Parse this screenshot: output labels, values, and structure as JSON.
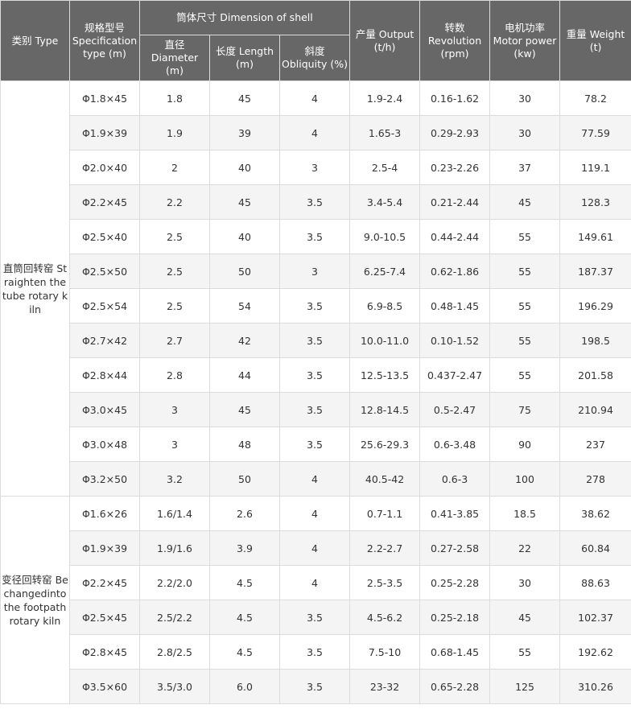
{
  "headers": {
    "type": "类别 Type",
    "spec": "规格型号 Specification type (m)",
    "shell": "筒体尺寸 Dimension of shell",
    "diameter": "直径 Diameter (m)",
    "length": "长度 Length (m)",
    "obliquity": "斜度 Obliquity (%)",
    "output": "产量 Output (t/h)",
    "revolution": "转数 Revolution (rpm)",
    "power": "电机功率 Motor power (kw)",
    "weight": "重量 Weight (t)"
  },
  "groups": [
    {
      "type": "直筒回转窑 Straighten the tube rotary kiln",
      "rows": [
        {
          "spec": "Φ1.8×45",
          "diameter": "1.8",
          "length": "45",
          "obliquity": "4",
          "output": "1.9-2.4",
          "revolution": "0.16-1.62",
          "power": "30",
          "weight": "78.2"
        },
        {
          "spec": "Φ1.9×39",
          "diameter": "1.9",
          "length": "39",
          "obliquity": "4",
          "output": "1.65-3",
          "revolution": "0.29-2.93",
          "power": "30",
          "weight": "77.59"
        },
        {
          "spec": "Φ2.0×40",
          "diameter": "2",
          "length": "40",
          "obliquity": "3",
          "output": "2.5-4",
          "revolution": "0.23-2.26",
          "power": "37",
          "weight": "119.1"
        },
        {
          "spec": "Φ2.2×45",
          "diameter": "2.2",
          "length": "45",
          "obliquity": "3.5",
          "output": "3.4-5.4",
          "revolution": "0.21-2.44",
          "power": "45",
          "weight": "128.3"
        },
        {
          "spec": "Φ2.5×40",
          "diameter": "2.5",
          "length": "40",
          "obliquity": "3.5",
          "output": "9.0-10.5",
          "revolution": "0.44-2.44",
          "power": "55",
          "weight": "149.61"
        },
        {
          "spec": "Φ2.5×50",
          "diameter": "2.5",
          "length": "50",
          "obliquity": "3",
          "output": "6.25-7.4",
          "revolution": "0.62-1.86",
          "power": "55",
          "weight": "187.37"
        },
        {
          "spec": "Φ2.5×54",
          "diameter": "2.5",
          "length": "54",
          "obliquity": "3.5",
          "output": "6.9-8.5",
          "revolution": "0.48-1.45",
          "power": "55",
          "weight": "196.29"
        },
        {
          "spec": "Φ2.7×42",
          "diameter": "2.7",
          "length": "42",
          "obliquity": "3.5",
          "output": "10.0-11.0",
          "revolution": "0.10-1.52",
          "power": "55",
          "weight": "198.5"
        },
        {
          "spec": "Φ2.8×44",
          "diameter": "2.8",
          "length": "44",
          "obliquity": "3.5",
          "output": "12.5-13.5",
          "revolution": "0.437-2.47",
          "power": "55",
          "weight": "201.58"
        },
        {
          "spec": "Φ3.0×45",
          "diameter": "3",
          "length": "45",
          "obliquity": "3.5",
          "output": "12.8-14.5",
          "revolution": "0.5-2.47",
          "power": "75",
          "weight": "210.94"
        },
        {
          "spec": "Φ3.0×48",
          "diameter": "3",
          "length": "48",
          "obliquity": "3.5",
          "output": "25.6-29.3",
          "revolution": "0.6-3.48",
          "power": "90",
          "weight": "237"
        },
        {
          "spec": "Φ3.2×50",
          "diameter": "3.2",
          "length": "50",
          "obliquity": "4",
          "output": "40.5-42",
          "revolution": "0.6-3",
          "power": "100",
          "weight": "278"
        }
      ]
    },
    {
      "type": "变径回转窑 Bechangedinto the footpath rotary kiln",
      "rows": [
        {
          "spec": "Φ1.6×26",
          "diameter": "1.6/1.4",
          "length": "2.6",
          "obliquity": "4",
          "output": "0.7-1.1",
          "revolution": "0.41-3.85",
          "power": "18.5",
          "weight": "38.62"
        },
        {
          "spec": "Φ1.9×39",
          "diameter": "1.9/1.6",
          "length": "3.9",
          "obliquity": "4",
          "output": "2.2-2.7",
          "revolution": "0.27-2.58",
          "power": "22",
          "weight": "60.84"
        },
        {
          "spec": "Φ2.2×45",
          "diameter": "2.2/2.0",
          "length": "4.5",
          "obliquity": "4",
          "output": "2.5-3.5",
          "revolution": "0.25-2.28",
          "power": "30",
          "weight": "88.63"
        },
        {
          "spec": "Φ2.5×45",
          "diameter": "2.5/2.2",
          "length": "4.5",
          "obliquity": "3.5",
          "output": "4.5-6.2",
          "revolution": "0.25-2.18",
          "power": "45",
          "weight": "102.37"
        },
        {
          "spec": "Φ2.8×45",
          "diameter": "2.8/2.5",
          "length": "4.5",
          "obliquity": "3.5",
          "output": "7.5-10",
          "revolution": "0.68-1.45",
          "power": "55",
          "weight": "192.62"
        },
        {
          "spec": "Φ3.5×60",
          "diameter": "3.5/3.0",
          "length": "6.0",
          "obliquity": "3.5",
          "output": "23-32",
          "revolution": "0.65-2.28",
          "power": "125",
          "weight": "310.26"
        }
      ]
    }
  ]
}
